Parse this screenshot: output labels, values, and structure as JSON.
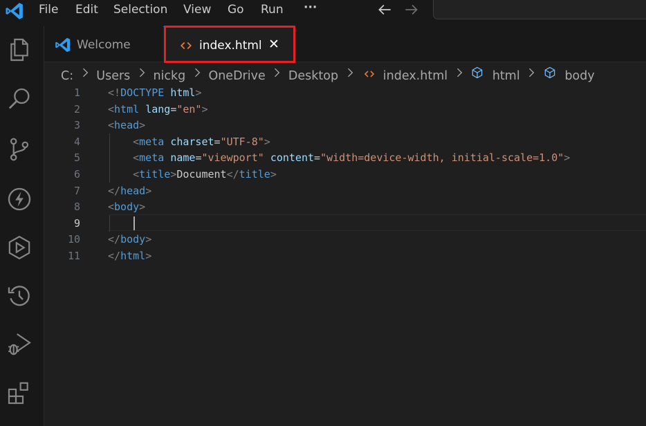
{
  "menu": {
    "items": [
      "File",
      "Edit",
      "Selection",
      "View",
      "Go",
      "Run",
      "···"
    ]
  },
  "icons": {
    "app": "vscode-logo-icon",
    "back": "arrow-left-icon",
    "forward": "arrow-right-icon",
    "activity": [
      "explorer-icon",
      "search-icon",
      "source-control-icon",
      "thunder-icon",
      "run-debug-icon",
      "timeline-icon",
      "debug-alt-icon",
      "extensions-icon"
    ]
  },
  "tabs": [
    {
      "label": "Welcome",
      "icon": "vscode-logo-icon"
    },
    {
      "label": "index.html",
      "icon": "html-file-icon",
      "close": "✕"
    }
  ],
  "breadcrumb": {
    "drive": "C:",
    "folders": [
      "Users",
      "nickg",
      "OneDrive",
      "Desktop"
    ],
    "file": "index.html",
    "symbols": [
      "html",
      "body"
    ]
  },
  "editor": {
    "line_numbers": [
      "1",
      "2",
      "3",
      "4",
      "5",
      "6",
      "7",
      "8",
      "9",
      "10",
      "11"
    ],
    "current_line": "9",
    "lines": [
      [
        [
          "punc",
          "<!"
        ],
        [
          "tag",
          "DOCTYPE"
        ],
        [
          "text",
          " "
        ],
        [
          "attr",
          "html"
        ],
        [
          "punc",
          ">"
        ]
      ],
      [
        [
          "punc",
          "<"
        ],
        [
          "tag",
          "html"
        ],
        [
          "text",
          " "
        ],
        [
          "attr",
          "lang"
        ],
        [
          "eq",
          "="
        ],
        [
          "str",
          "\"en\""
        ],
        [
          "punc",
          ">"
        ]
      ],
      [
        [
          "punc",
          "<"
        ],
        [
          "tag",
          "head"
        ],
        [
          "punc",
          ">"
        ]
      ],
      [
        [
          "text",
          "    "
        ],
        [
          "punc",
          "<"
        ],
        [
          "tag",
          "meta"
        ],
        [
          "text",
          " "
        ],
        [
          "attr",
          "charset"
        ],
        [
          "eq",
          "="
        ],
        [
          "str",
          "\"UTF-8\""
        ],
        [
          "punc",
          ">"
        ]
      ],
      [
        [
          "text",
          "    "
        ],
        [
          "punc",
          "<"
        ],
        [
          "tag",
          "meta"
        ],
        [
          "text",
          " "
        ],
        [
          "attr",
          "name"
        ],
        [
          "eq",
          "="
        ],
        [
          "str",
          "\"viewport\""
        ],
        [
          "text",
          " "
        ],
        [
          "attr",
          "content"
        ],
        [
          "eq",
          "="
        ],
        [
          "str",
          "\"width=device-width, initial-scale=1.0\""
        ],
        [
          "punc",
          ">"
        ]
      ],
      [
        [
          "text",
          "    "
        ],
        [
          "punc",
          "<"
        ],
        [
          "tag",
          "title"
        ],
        [
          "punc",
          ">"
        ],
        [
          "text",
          "Document"
        ],
        [
          "punc",
          "</"
        ],
        [
          "tag",
          "title"
        ],
        [
          "punc",
          ">"
        ]
      ],
      [
        [
          "punc",
          "</"
        ],
        [
          "tag",
          "head"
        ],
        [
          "punc",
          ">"
        ]
      ],
      [
        [
          "punc",
          "<"
        ],
        [
          "tag",
          "body"
        ],
        [
          "punc",
          ">"
        ]
      ],
      [
        [
          "text",
          "    "
        ]
      ],
      [
        [
          "punc",
          "</"
        ],
        [
          "tag",
          "body"
        ],
        [
          "punc",
          ">"
        ]
      ],
      [
        [
          "punc",
          "</"
        ],
        [
          "tag",
          "html"
        ],
        [
          "punc",
          ">"
        ]
      ]
    ]
  },
  "colors": {
    "accent": "#0078d4",
    "highlight": "#e32227",
    "html_icon": "#e37933",
    "tag": "#569cd6",
    "attribute": "#9cdcfe",
    "string": "#ce9178"
  }
}
